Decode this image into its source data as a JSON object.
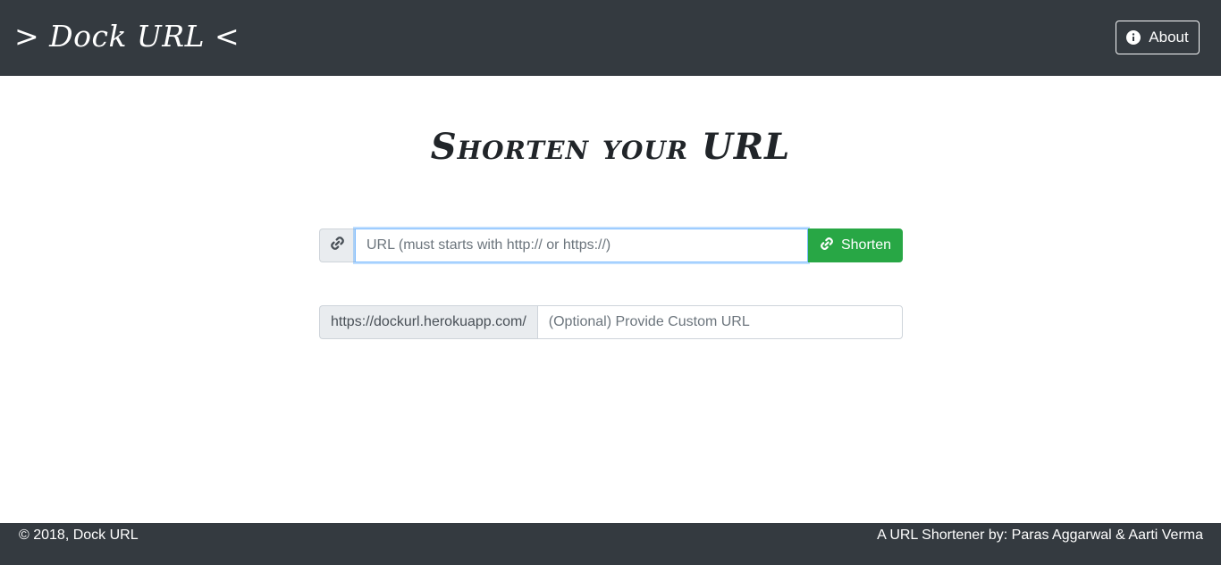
{
  "header": {
    "brand": "> Dock URL <",
    "about_label": "About",
    "about_icon": "info-circle-icon"
  },
  "main": {
    "headline": "Shorten your URL",
    "url_input": {
      "icon": "link-icon",
      "placeholder": "URL (must starts with http:// or https://)",
      "value": ""
    },
    "shorten_button": {
      "icon": "link-icon",
      "label": "Shorten"
    },
    "custom_url": {
      "prefix": "https://dockurl.herokuapp.com/",
      "placeholder": "(Optional) Provide Custom URL",
      "value": ""
    }
  },
  "footer": {
    "copyright": "© 2018, Dock URL",
    "credits": "A URL Shortener by: Paras Aggarwal & Aarti Verma"
  },
  "colors": {
    "navbar_bg": "#343a40",
    "success": "#28a745",
    "addon_bg": "#e9ecef",
    "focus_border": "#80bdff"
  }
}
